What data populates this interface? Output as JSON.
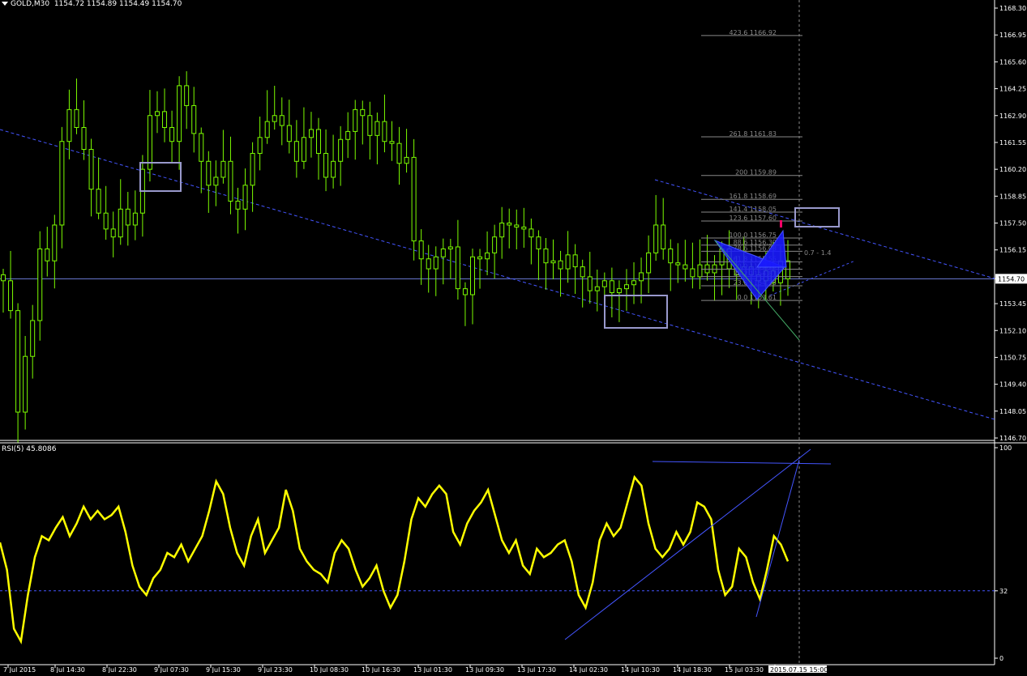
{
  "header": {
    "symbol": "GOLD,M30",
    "open": "1154.72",
    "high": "1154.89",
    "low": "1154.49",
    "close": "1154.70"
  },
  "rsi_header": {
    "label": "RSI(5)",
    "value": "45.8086"
  },
  "colors": {
    "background": "#000000",
    "candles": "#7CFC00",
    "rsi_line": "#FFFF00",
    "trendlines": "#4455FF",
    "annotation_box": "#9999CC",
    "fib": "#888888",
    "pattern_fill": "#1a1aff",
    "marker": "#ff0066"
  },
  "chart_data": [
    {
      "type": "candlestick",
      "title": "GOLD,M30",
      "ylim": [
        1146.7,
        1168.3
      ],
      "y_ticks": [
        "1168.30",
        "1166.95",
        "1165.60",
        "1164.25",
        "1162.90",
        "1161.55",
        "1160.20",
        "1158.85",
        "1157.50",
        "1156.15",
        "1154.70",
        "1153.45",
        "1152.10",
        "1150.75",
        "1149.40",
        "1148.05",
        "1146.70"
      ],
      "current_price": "1154.70",
      "x_ticks": [
        "7 Jul 2015",
        "8 Jul 14:30",
        "8 Jul 22:30",
        "9 Jul 07:30",
        "9 Jul 15:30",
        "9 Jul 23:30",
        "10 Jul 08:30",
        "10 Jul 16:30",
        "13 Jul 01:30",
        "13 Jul 09:30",
        "13 Jul 17:30",
        "14 Jul 02:30",
        "14 Jul 10:30",
        "14 Jul 18:30",
        "15 Jul 03:30",
        "2015.07.15 15:00"
      ],
      "closes": [
        1154.6,
        1153.1,
        1148.0,
        1150.8,
        1152.6,
        1156.2,
        1155.6,
        1157.4,
        1161.6,
        1163.2,
        1162.3,
        1161.2,
        1159.2,
        1158.0,
        1157.2,
        1156.8,
        1158.2,
        1157.4,
        1158.0,
        1160.2,
        1162.9,
        1163.1,
        1162.3,
        1161.6,
        1164.4,
        1163.4,
        1162.0,
        1160.6,
        1159.4,
        1159.8,
        1160.6,
        1158.6,
        1158.2,
        1159.4,
        1161.0,
        1161.8,
        1162.6,
        1162.9,
        1162.4,
        1161.6,
        1160.6,
        1161.8,
        1162.2,
        1161.0,
        1159.8,
        1160.6,
        1161.7,
        1162.1,
        1163.2,
        1162.9,
        1161.9,
        1162.6,
        1161.6,
        1161.5,
        1160.5,
        1160.8,
        1156.6,
        1155.7,
        1155.2,
        1155.8,
        1156.2,
        1156.3,
        1154.2,
        1153.9,
        1155.8,
        1155.7,
        1156.0,
        1156.8,
        1157.5,
        1157.4,
        1157.3,
        1157.2,
        1156.8,
        1156.2,
        1155.5,
        1155.6,
        1155.2,
        1155.9,
        1155.3,
        1154.8,
        1154.1,
        1154.3,
        1154.6,
        1154.0,
        1154.2,
        1154.4,
        1154.6,
        1155.0,
        1156.0,
        1157.4,
        1156.2,
        1155.5,
        1155.4,
        1155.2,
        1154.8,
        1155.4,
        1155.0,
        1155.4,
        1156.2,
        1155.2,
        1154.9,
        1155.3,
        1154.9,
        1154.6,
        1155.1,
        1154.5,
        1155.6,
        1154.7
      ],
      "fibonacci_levels": [
        {
          "level": "423.6",
          "price": "1166.92"
        },
        {
          "level": "261.8",
          "price": "1161.83"
        },
        {
          "level": "200",
          "price": "1159.89"
        },
        {
          "level": "161.8",
          "price": "1158.69"
        },
        {
          "level": "141.4",
          "price": "1158.05"
        },
        {
          "level": "123.6",
          "price": "1157.60"
        },
        {
          "level": "100.0",
          "price": "1156.75"
        },
        {
          "level": "88.6",
          "price": "1156.39"
        },
        {
          "level": "78.6",
          "price": "1156.08"
        },
        {
          "level": "61.8",
          "price": "1155.55"
        },
        {
          "level": "50.0",
          "price": "1155.18"
        },
        {
          "level": "38.2",
          "price": "1154.81"
        },
        {
          "level": "23.6",
          "price": "1154.35"
        },
        {
          "level": "0.0",
          "price": "1153.61"
        }
      ],
      "fib_extra_label": "0.7 - 1.4"
    },
    {
      "type": "line",
      "title": "RSI(5) 45.8086",
      "ylim": [
        0,
        100
      ],
      "y_ticks": [
        "100",
        "32",
        "0"
      ],
      "level_line": 32,
      "values": [
        55,
        42,
        14,
        8,
        30,
        48,
        58,
        56,
        62,
        67,
        58,
        64,
        72,
        66,
        70,
        66,
        68,
        72,
        60,
        44,
        34,
        30,
        38,
        42,
        50,
        48,
        54,
        46,
        52,
        58,
        70,
        84,
        78,
        62,
        50,
        44,
        58,
        66,
        50,
        56,
        62,
        80,
        70,
        52,
        46,
        42,
        40,
        36,
        50,
        56,
        52,
        42,
        34,
        38,
        44,
        32,
        24,
        30,
        46,
        66,
        76,
        72,
        78,
        82,
        78,
        60,
        54,
        64,
        70,
        74,
        80,
        68,
        56,
        50,
        56,
        44,
        40,
        52,
        48,
        50,
        54,
        56,
        46,
        30,
        24,
        36,
        56,
        64,
        58,
        62,
        74,
        86,
        82,
        64,
        52,
        48,
        52,
        60,
        54,
        60,
        74,
        72,
        66,
        42,
        30,
        34,
        52,
        48,
        36,
        28,
        42,
        58,
        54,
        46
      ]
    }
  ]
}
